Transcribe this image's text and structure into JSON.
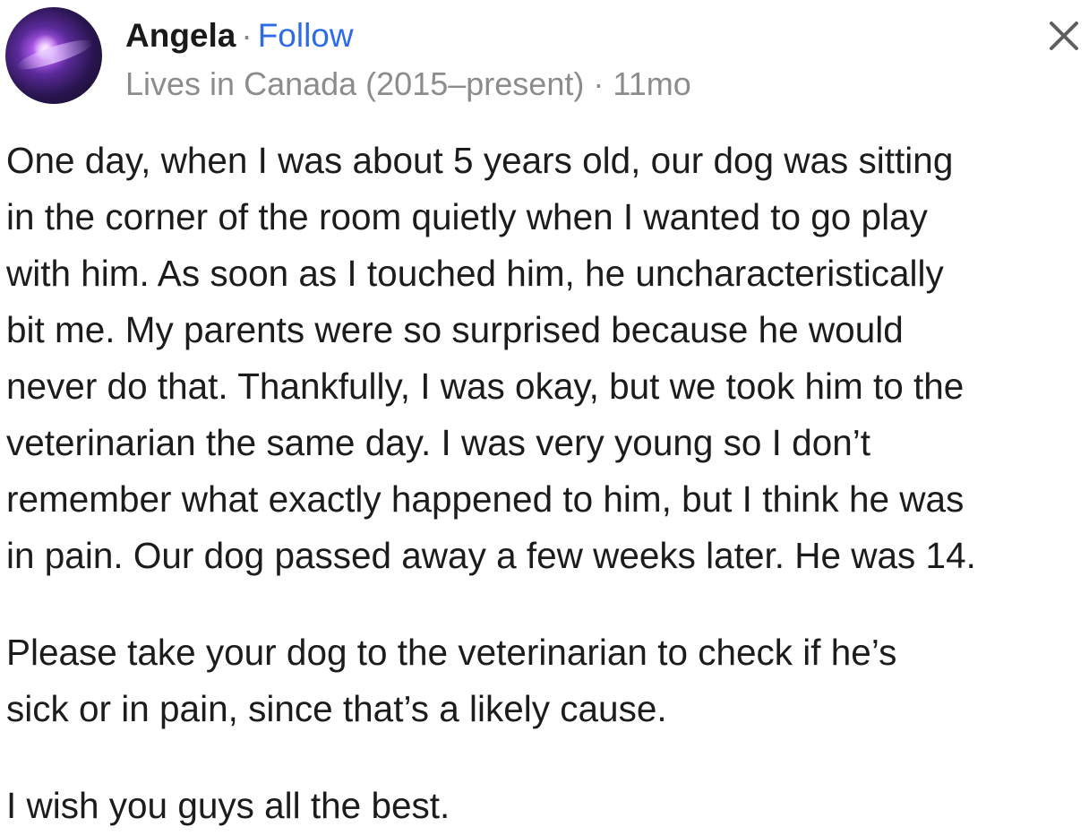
{
  "post": {
    "author": {
      "name": "Angela",
      "separator": "·",
      "follow_label": "Follow"
    },
    "meta": {
      "credential": "Lives in Canada (2015–present)",
      "separator": "·",
      "age": "11mo"
    },
    "close_icon": "close-icon",
    "paragraphs": [
      {
        "lines": [
          "One day, when I was about 5 years old, our dog was sitting",
          "in the corner of the room quietly when I wanted to go play",
          "with him. As soon as I touched him, he uncharacteristically",
          "bit me. My parents were so surprised because he would",
          "never do that. Thankfully, I was okay, but we took him to the",
          "veterinarian the same day. I was very young so I don’t",
          "remember what exactly happened to him, but I think he was",
          "in pain. Our dog passed away a few weeks later. He was 14."
        ]
      },
      {
        "lines": [
          "Please take your dog to the veterinarian to check if he’s",
          "sick or in pain, since that’s a likely cause."
        ]
      },
      {
        "lines": [
          "I wish you guys all the best."
        ]
      }
    ]
  },
  "colors": {
    "follow": "#2e6be6",
    "meta_text": "#8c8c8c",
    "body_text": "#1c1c1c"
  }
}
